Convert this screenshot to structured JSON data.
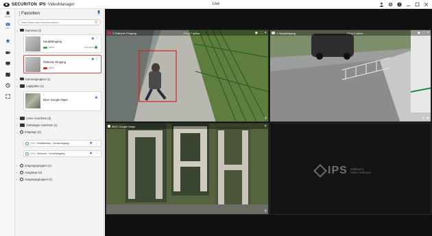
{
  "app": {
    "brand_primary": "SECURITON",
    "brand_secondary": "IPS",
    "brand_product": "VideoManager",
    "window_title": "Live"
  },
  "rail": {
    "items": [
      {
        "label": "Home",
        "icon": "home-icon"
      },
      {
        "label": "Live",
        "icon": "eye-icon"
      },
      {
        "label": "",
        "icon": "star-icon"
      },
      {
        "label": "",
        "icon": "camera-icon"
      },
      {
        "label": "",
        "icon": "monitor-icon"
      },
      {
        "label": "",
        "icon": "map-icon"
      },
      {
        "label": "",
        "icon": "history-icon"
      },
      {
        "label": "",
        "icon": "layout-icon"
      }
    ]
  },
  "sidebar": {
    "title": "Favoriten",
    "search_placeholder": "Nach Name oder Nummer suchen",
    "cameras_group": "Kameras (2)",
    "cameras": [
      {
        "name": "Hauptstingang",
        "status": "active",
        "primary": "Primärerot",
        "selected": false
      },
      {
        "name": "Östlicher Eingang",
        "status": "alarm",
        "primary": "",
        "selected": true
      }
    ],
    "groups_after": [
      "Kameragruppen (1)",
      "Lagepläne (1)"
    ],
    "map_card": {
      "number": "1",
      "name": "MUC Google Maps"
    },
    "more_groups": [
      "Leere Ansichten (2)",
      "Vorbelegte Ansichten (1)",
      "Eingänge (2)"
    ],
    "entrances": [
      {
        "number": "1002",
        "name": "Kontaktleser - Vordereingang"
      },
      {
        "number": "1003",
        "name": "Intercom - Vordereingang"
      }
    ],
    "tail_groups": [
      "Eingangsgruppen (1)",
      "Ausgänge (2)",
      "Ausgangsgruppen (1)"
    ]
  },
  "tiles": [
    {
      "title": "2 Östlicher Eingang",
      "overlay": "Prog 7 active"
    },
    {
      "title": "1 Hauptsingang",
      "overlay": "Prog 4 active"
    },
    {
      "title": "MUC Google Maps",
      "overlay": ""
    },
    {
      "title": "",
      "overlay": ""
    }
  ],
  "ips_logo": {
    "name": "IPS",
    "line1": "Intelligent",
    "line2": "Video Software"
  },
  "colors": {
    "accent": "#1d5fd1",
    "alarm": "#d22222",
    "active": "#3aa54a"
  }
}
